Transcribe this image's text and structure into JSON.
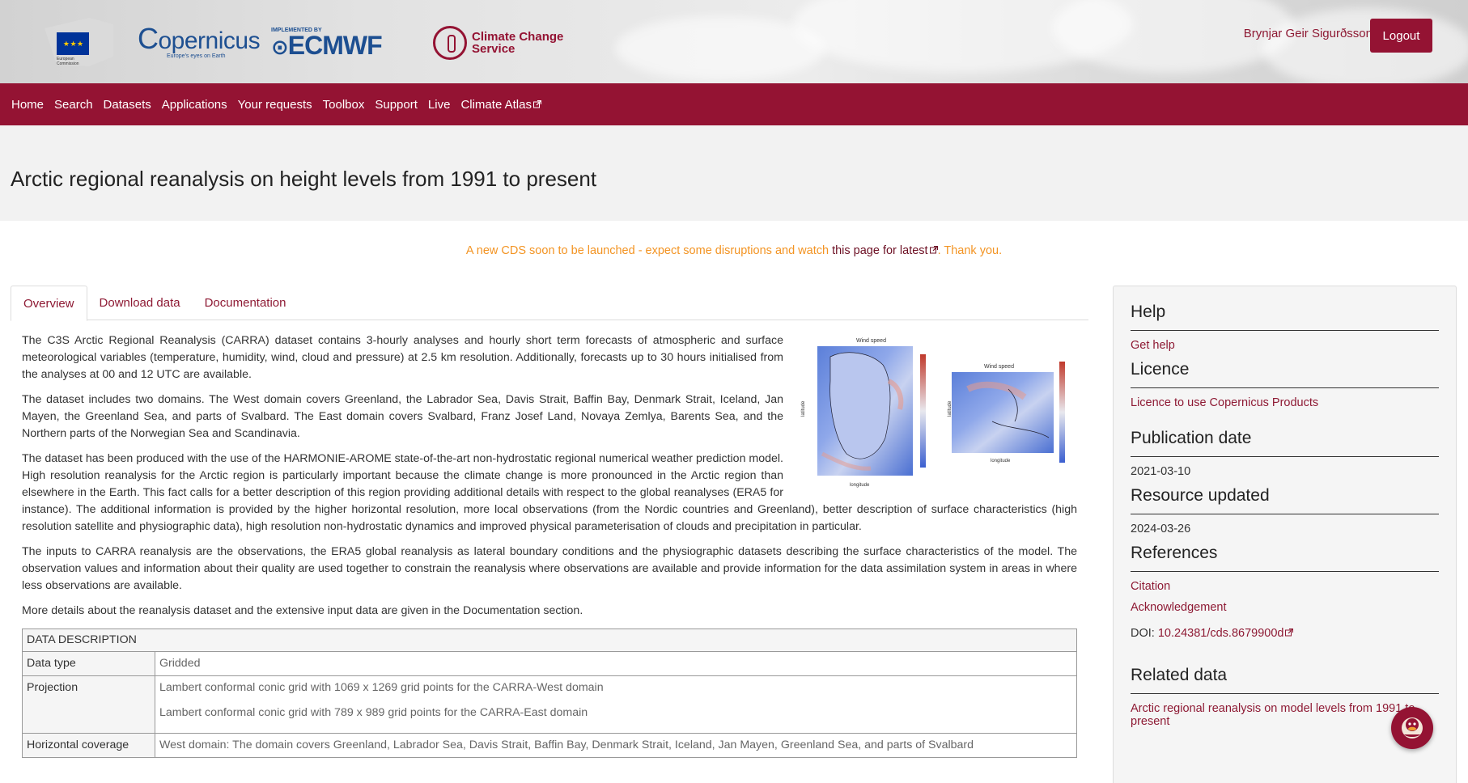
{
  "header": {
    "eu_logo_text": "European Commission",
    "copernicus_logo": "opernicus",
    "copernicus_tagline": "Europe's eyes on Earth",
    "ecmwf_implemented": "IMPLEMENTED BY",
    "ecmwf_logo": "ECMWF",
    "c3s_line1": "Climate Change",
    "c3s_line2": "Service",
    "user_name": "Brynjar Geir Sigurðsson",
    "logout_label": "Logout"
  },
  "nav": {
    "items": [
      "Home",
      "Search",
      "Datasets",
      "Applications",
      "Your requests",
      "Toolbox",
      "Support",
      "Live",
      "Climate Atlas"
    ]
  },
  "page": {
    "title": "Arctic regional reanalysis on height levels from 1991 to present",
    "notice_prefix": "A new CDS soon to be launched - expect some disruptions and watch ",
    "notice_link": "this page for latest",
    "notice_suffix": ". Thank you."
  },
  "tabs": [
    "Overview",
    "Download data",
    "Documentation"
  ],
  "overview": {
    "paragraphs": [
      "The C3S Arctic Regional Reanalysis (CARRA) dataset contains 3-hourly analyses and hourly short term forecasts of atmospheric and surface meteorological variables (temperature, humidity, wind, cloud and pressure) at 2.5 km resolution. Additionally, forecasts up to 30 hours initialised from the analyses at 00 and 12 UTC are available.",
      "The dataset includes two domains. The West domain covers Greenland, the Labrador Sea, Davis Strait, Baffin Bay, Denmark Strait, Iceland, Jan Mayen, the Greenland Sea, and parts of Svalbard. The East domain covers Svalbard, Franz Josef Land, Novaya Zemlya, Barents Sea, and the Northern parts of the Norwegian Sea and Scandinavia.",
      "The dataset has been produced with the use of the HARMONIE-AROME state-of-the-art non-hydrostatic regional numerical weather prediction model. High resolution reanalysis for the Arctic region is particularly important because the climate change is more pronounced in the Arctic region than elsewhere in the Earth. This fact calls for a better description of this region providing additional details with respect to the global reanalyses (ERA5 for instance). The additional information is provided by the higher horizontal resolution, more local observations (from the Nordic countries and Greenland), better description of surface characteristics (high resolution satellite and physiographic data), high resolution non-hydrostatic dynamics and improved physical parameterisation of clouds and precipitation in particular.",
      "The inputs to CARRA reanalysis are the observations, the ERA5 global reanalysis as lateral boundary conditions and the physiographic datasets describing the surface characteristics of the model. The observation values and information about their quality are used together to constrain the reanalysis where observations are available and provide information for the data assimilation system in areas in where less observations are available.",
      "More details about the reanalysis dataset and the extensive input data are given in the Documentation section."
    ],
    "figure": {
      "left_title": "Wind speed",
      "right_title": "Wind speed",
      "xlabel": "longitude",
      "ylabel": "latitude"
    }
  },
  "description_table": {
    "header": "DATA DESCRIPTION",
    "rows": [
      {
        "key": "Data type",
        "values": [
          "Gridded"
        ]
      },
      {
        "key": "Projection",
        "values": [
          "Lambert conformal conic grid with 1069 x 1269 grid points for the CARRA-West domain",
          "Lambert conformal conic grid with 789 x 989 grid points for the CARRA-East domain"
        ]
      },
      {
        "key": "Horizontal coverage",
        "values": [
          "West domain: The domain covers Greenland, Labrador Sea, Davis Strait, Baffin Bay, Denmark Strait, Iceland, Jan Mayen, Greenland Sea, and parts of Svalbard"
        ]
      }
    ]
  },
  "sidebar": {
    "help_heading": "Help",
    "help_link": "Get help",
    "licence_heading": "Licence",
    "licence_link": "Licence to use Copernicus Products",
    "publication_heading": "Publication date",
    "publication_date": "2021-03-10",
    "updated_heading": "Resource updated",
    "updated_date": "2024-03-26",
    "references_heading": "References",
    "citation_link": "Citation",
    "ack_link": "Acknowledgement",
    "doi_label": "DOI: ",
    "doi_value": "10.24381/cds.8679900d",
    "related_heading": "Related data",
    "related_link": "Arctic regional reanalysis on model levels from 1991 to present"
  },
  "colors": {
    "brand": "#941333",
    "notice": "#f39423",
    "link": "#8e1a34"
  }
}
